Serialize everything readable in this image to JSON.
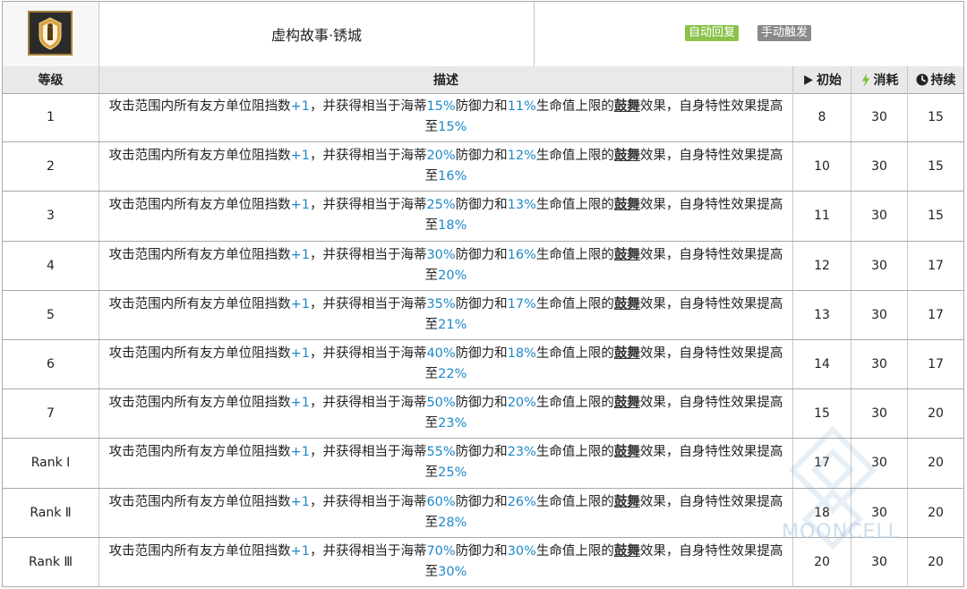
{
  "skill": {
    "name": "虚构故事·锈城",
    "tags": {
      "auto": "自动回复",
      "manual": "手动触发"
    }
  },
  "columns": {
    "level": "等级",
    "desc": "描述",
    "init": "初始",
    "cost": "消耗",
    "duration": "持续"
  },
  "desc_parts": {
    "p1": "攻击范围内所有友方单位阻挡数",
    "block": "+1",
    "p2": "，并获得相当于海蒂",
    "p3": "防御力和",
    "p4": "生命值上限的",
    "keyword": "鼓舞",
    "p5": "效果，自身特性效果提高至"
  },
  "rows": [
    {
      "level": "1",
      "def": "15%",
      "hp": "11%",
      "trait": "15%",
      "init": "8",
      "cost": "30",
      "dur": "15"
    },
    {
      "level": "2",
      "def": "20%",
      "hp": "12%",
      "trait": "16%",
      "init": "10",
      "cost": "30",
      "dur": "15"
    },
    {
      "level": "3",
      "def": "25%",
      "hp": "13%",
      "trait": "18%",
      "init": "11",
      "cost": "30",
      "dur": "15"
    },
    {
      "level": "4",
      "def": "30%",
      "hp": "16%",
      "trait": "20%",
      "init": "12",
      "cost": "30",
      "dur": "17"
    },
    {
      "level": "5",
      "def": "35%",
      "hp": "17%",
      "trait": "21%",
      "init": "13",
      "cost": "30",
      "dur": "17"
    },
    {
      "level": "6",
      "def": "40%",
      "hp": "18%",
      "trait": "22%",
      "init": "14",
      "cost": "30",
      "dur": "17"
    },
    {
      "level": "7",
      "def": "50%",
      "hp": "20%",
      "trait": "23%",
      "init": "15",
      "cost": "30",
      "dur": "20"
    },
    {
      "level": "Rank Ⅰ",
      "def": "55%",
      "hp": "23%",
      "trait": "25%",
      "init": "17",
      "cost": "30",
      "dur": "20"
    },
    {
      "level": "Rank Ⅱ",
      "def": "60%",
      "hp": "26%",
      "trait": "28%",
      "init": "18",
      "cost": "30",
      "dur": "20"
    },
    {
      "level": "Rank Ⅲ",
      "def": "70%",
      "hp": "30%",
      "trait": "30%",
      "init": "20",
      "cost": "30",
      "dur": "20"
    }
  ],
  "watermark": "MOONCELL",
  "colors": {
    "highlight": "#1e88c8",
    "tag_auto": "#8bc34a",
    "tag_manual": "#8a8a8a",
    "sp_icon": "#7cc23a"
  },
  "icons": {
    "init": "play-icon",
    "cost": "lightning-icon",
    "duration": "clock-icon"
  }
}
